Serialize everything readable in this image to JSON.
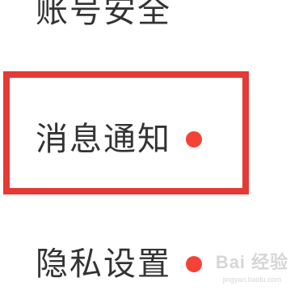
{
  "settings_menu": {
    "items": [
      {
        "label": "账号安全",
        "has_badge": false
      },
      {
        "label": "消息通知",
        "has_badge": true
      },
      {
        "label": "隐私设置",
        "has_badge": true
      }
    ]
  },
  "badge_color": "#f44336",
  "highlight_color": "#e53935",
  "watermark": {
    "title": "Bai 经验",
    "url": "jingyan.baidu.com"
  }
}
